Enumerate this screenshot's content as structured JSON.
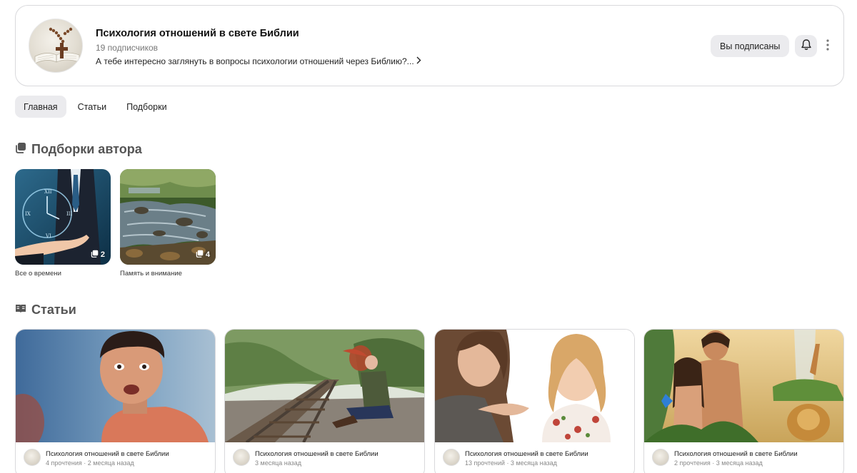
{
  "channel": {
    "title": "Психология отношений в свете Библии",
    "subscribers": "19 подписчиков",
    "description": "А тебе интересно заглянуть в вопросы психологии отношений через Библию?...",
    "subscribed_label": "Вы подписаны"
  },
  "tabs": [
    {
      "label": "Главная",
      "active": true
    },
    {
      "label": "Статьи",
      "active": false
    },
    {
      "label": "Подборки",
      "active": false
    }
  ],
  "collections_section": {
    "heading": "Подборки автора",
    "items": [
      {
        "label": "Все о времени",
        "count": "2"
      },
      {
        "label": "Память и внимание",
        "count": "4"
      }
    ]
  },
  "articles_section": {
    "heading": "Статьи",
    "items": [
      {
        "author": "Психология отношений в свете Библии",
        "stats": "4 прочтения · 2 месяца назад"
      },
      {
        "author": "Психология отношений в свете Библии",
        "stats": "3 месяца назад"
      },
      {
        "author": "Психология отношений в свете Библии",
        "stats": "13 прочтений · 3 месяца назад"
      },
      {
        "author": "Психология отношений в свете Библии",
        "stats": "2 прочтения · 3 месяца назад"
      }
    ]
  },
  "icons": {
    "bell": "bell-icon",
    "more": "more-vertical-icon",
    "collections": "collections-icon",
    "articles": "articles-icon",
    "chevron": "chevron-right-icon"
  },
  "colors": {
    "chip_bg": "#ebebee",
    "border": "#d9d9dc",
    "muted_text": "#777777",
    "heading_text": "#555555"
  }
}
